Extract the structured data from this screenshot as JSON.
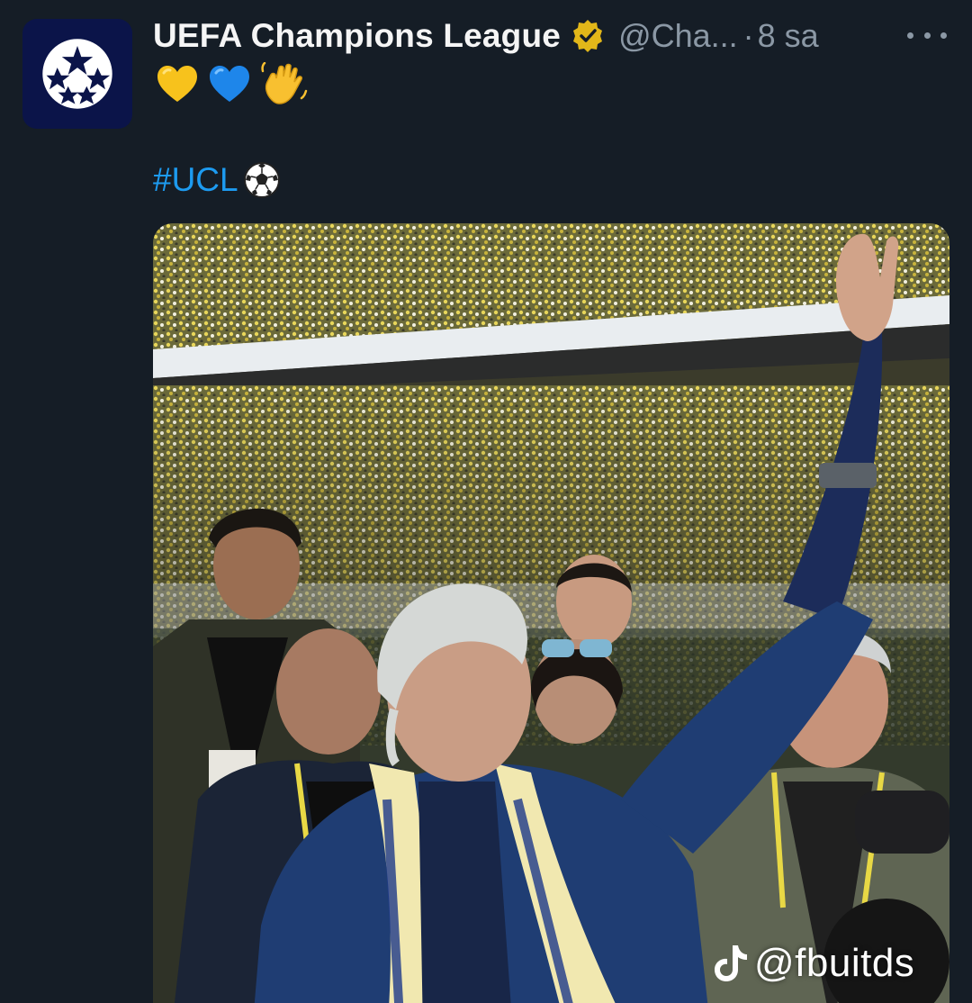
{
  "account": {
    "display_name": "UEFA Champions League",
    "handle": "@Cha...",
    "separator": "·",
    "time": "8 sa"
  },
  "tweet": {
    "emojis": [
      "yellow-heart",
      "blue-heart",
      "waving-hand"
    ],
    "hashtag": "#UCL"
  },
  "media": {
    "alt_watermark_handle": "@fbuitds",
    "watermark_icon": "tiktok-icon"
  },
  "colors": {
    "background": "#151d26",
    "hashtag": "#1d9bf0",
    "verified_badge": "#e2b719",
    "secondary_text": "#8b98a5"
  }
}
